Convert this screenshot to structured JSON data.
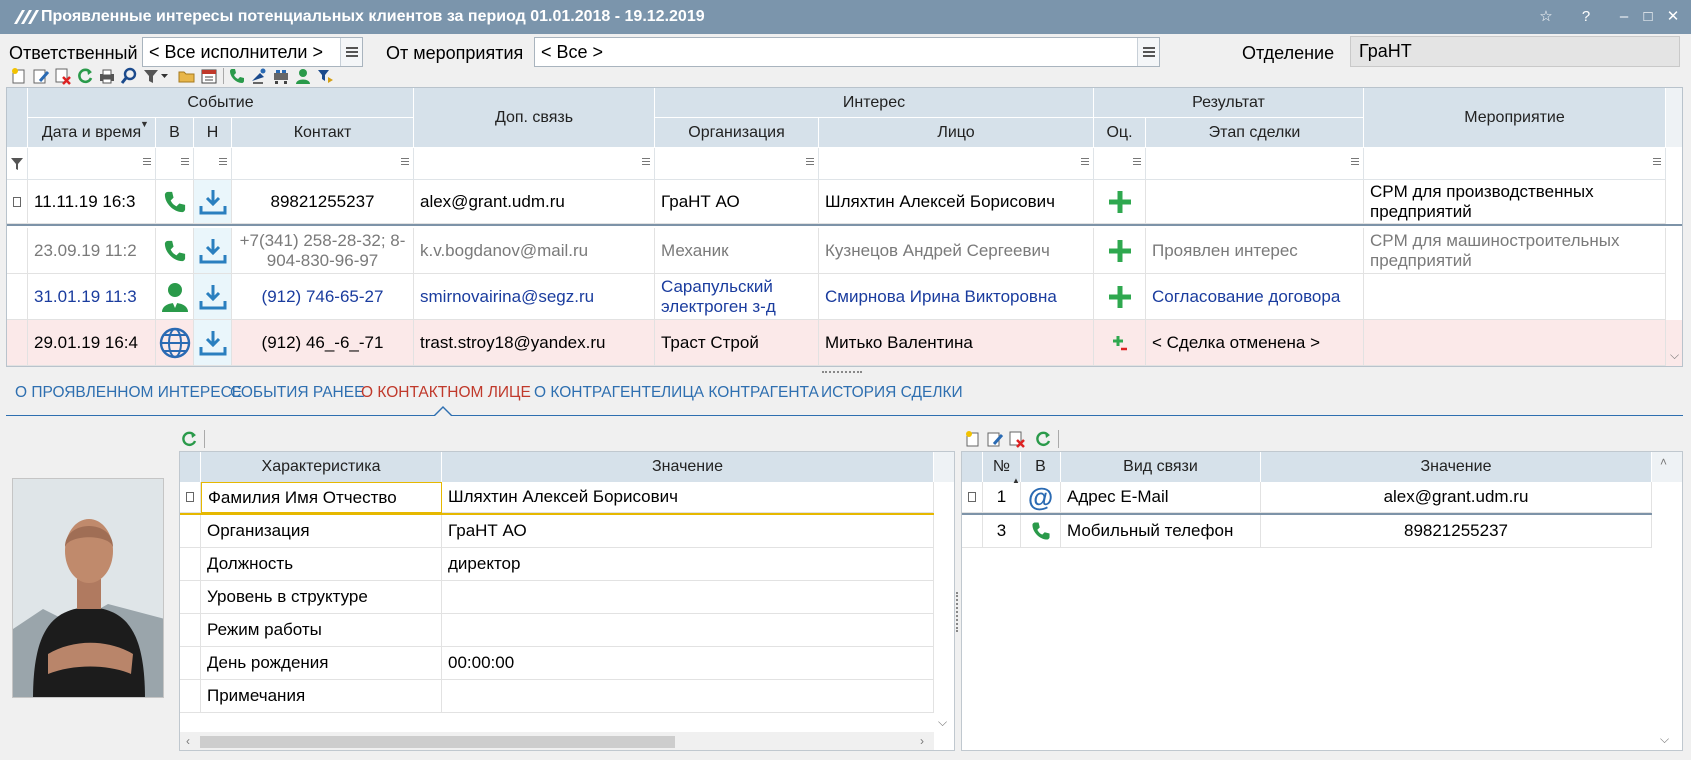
{
  "window": {
    "title": "Проявленные интересы потенциальных клиентов за период 01.01.2018 - 19.12.2019",
    "buttons": {
      "star": "☆",
      "help": "?",
      "minimize": "–",
      "maximize": "□",
      "close": "✕"
    }
  },
  "filters": {
    "responsible_label": "Ответственный",
    "responsible_value": "< Все исполнители >",
    "event_label": "От мероприятия",
    "event_value": "< Все >",
    "department_label": "Отделение",
    "department_value": "ГраНТ"
  },
  "toolbar": {
    "icons": [
      "new-doc-icon",
      "edit-doc-icon",
      "delete-doc-icon",
      "refresh-icon",
      "print-icon",
      "search-icon",
      "filter-icon",
      "folder-icon",
      "calendar-icon",
      "phone-icon",
      "broadcast-icon",
      "equipment-icon",
      "user-icon",
      "export-icon"
    ]
  },
  "grid": {
    "groups": {
      "event": "Событие",
      "extra": "Доп. связь",
      "interest": "Интерес",
      "result": "Результат",
      "activity": "Мероприятие"
    },
    "columns": {
      "datetime": "Дата и время",
      "in": "В",
      "out": "Н",
      "contact": "Контакт",
      "org": "Организация",
      "person": "Лицо",
      "score": "Оц.",
      "stage": "Этап сделки"
    },
    "rows": [
      {
        "datetime": "11.11.19 16:3",
        "channel": "phone",
        "contact": "89821255237",
        "extra": "alex@grant.udm.ru",
        "org": "ГраНТ АО",
        "person": "Шляхтин Алексей Борисович",
        "score": "plus",
        "stage": "",
        "activity": "CPM для производственных предприятий",
        "style": "normal"
      },
      {
        "datetime": "23.09.19 11:2",
        "channel": "phone",
        "contact": "+7(341) 258-28-32; 8-904-830-96-97",
        "extra": "k.v.bogdanov@mail.ru",
        "org": "Механик",
        "person": "Кузнецов Андрей Сергеевич",
        "score": "plus",
        "stage": "Проявлен интерес",
        "activity": "CPM для машиностроительных предприятий",
        "style": "gray"
      },
      {
        "datetime": "31.01.19 11:3",
        "channel": "person",
        "contact": "(912) 746-65-27",
        "extra": "smirnovairina@segz.ru",
        "org": "Сарапульский электроген з-д",
        "person": "Смирнова Ирина Викторовна",
        "score": "plus",
        "stage": "Согласование договора",
        "activity": "",
        "style": "blue"
      },
      {
        "datetime": "29.01.19 16:4",
        "channel": "web",
        "contact": "(912) 46_-6_-71",
        "extra": "trast.stroy18@yandex.ru",
        "org": "Траст Строй",
        "person": "Митько Валентина",
        "score": "small-plus",
        "stage": "< Сделка отменена >",
        "activity": "",
        "style": "pink"
      }
    ]
  },
  "tabs": [
    {
      "label": "О ПРОЯВЛЕННОМ ИНТЕРЕСЕ",
      "active": false
    },
    {
      "label": "СОБЫТИЯ РАНЕЕ",
      "active": false
    },
    {
      "label": "О КОНТАКТНОМ ЛИЦЕ",
      "active": true
    },
    {
      "label": "О КОНТРАГЕНТЕ",
      "active": false
    },
    {
      "label": "ЛИЦА КОНТРАГЕНТА",
      "active": false
    },
    {
      "label": "ИСТОРИЯ СДЕЛКИ",
      "active": false
    }
  ],
  "person_card": {
    "columns": {
      "attr": "Характеристика",
      "value": "Значение"
    },
    "rows": [
      {
        "attr": "Фамилия Имя Отчество",
        "value": "Шляхтин Алексей Борисович"
      },
      {
        "attr": "Организация",
        "value": "ГраНТ АО"
      },
      {
        "attr": "Должность",
        "value": "директор"
      },
      {
        "attr": "Уровень в структуре",
        "value": ""
      },
      {
        "attr": "Режим работы",
        "value": ""
      },
      {
        "attr": "День рождения",
        "value": "00:00:00"
      },
      {
        "attr": "Примечания",
        "value": ""
      }
    ]
  },
  "contacts": {
    "columns": {
      "no": "№",
      "in": "В",
      "type": "Вид связи",
      "value": "Значение"
    },
    "rows": [
      {
        "no": "1",
        "icon": "at-icon",
        "type": "Адрес E-Mail",
        "value": "alex@grant.udm.ru"
      },
      {
        "no": "3",
        "icon": "phone-icon",
        "type": "Мобильный телефон",
        "value": "89821255237"
      }
    ]
  }
}
